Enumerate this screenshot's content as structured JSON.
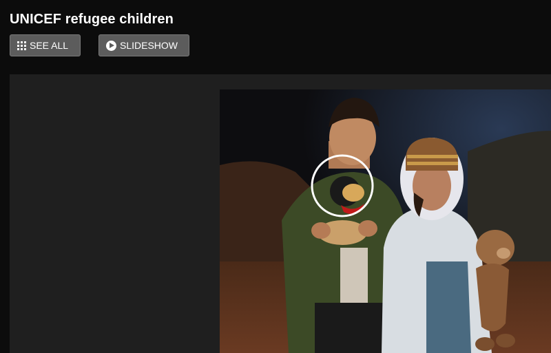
{
  "header": {
    "title": "UNICEF refugee children"
  },
  "toolbar": {
    "see_all_label": "SEE ALL",
    "see_all_icon": "grid-icon",
    "slideshow_label": "SLIDESHOW",
    "slideshow_icon": "play-icon"
  },
  "gallery": {
    "photo_description_icon": "photo-two-children-with-teddy-bears",
    "highlight_color": "#ffffff"
  },
  "colors": {
    "background": "#0c0c0c",
    "stage": "#1f1f1f",
    "button": "#5c5c5c"
  }
}
